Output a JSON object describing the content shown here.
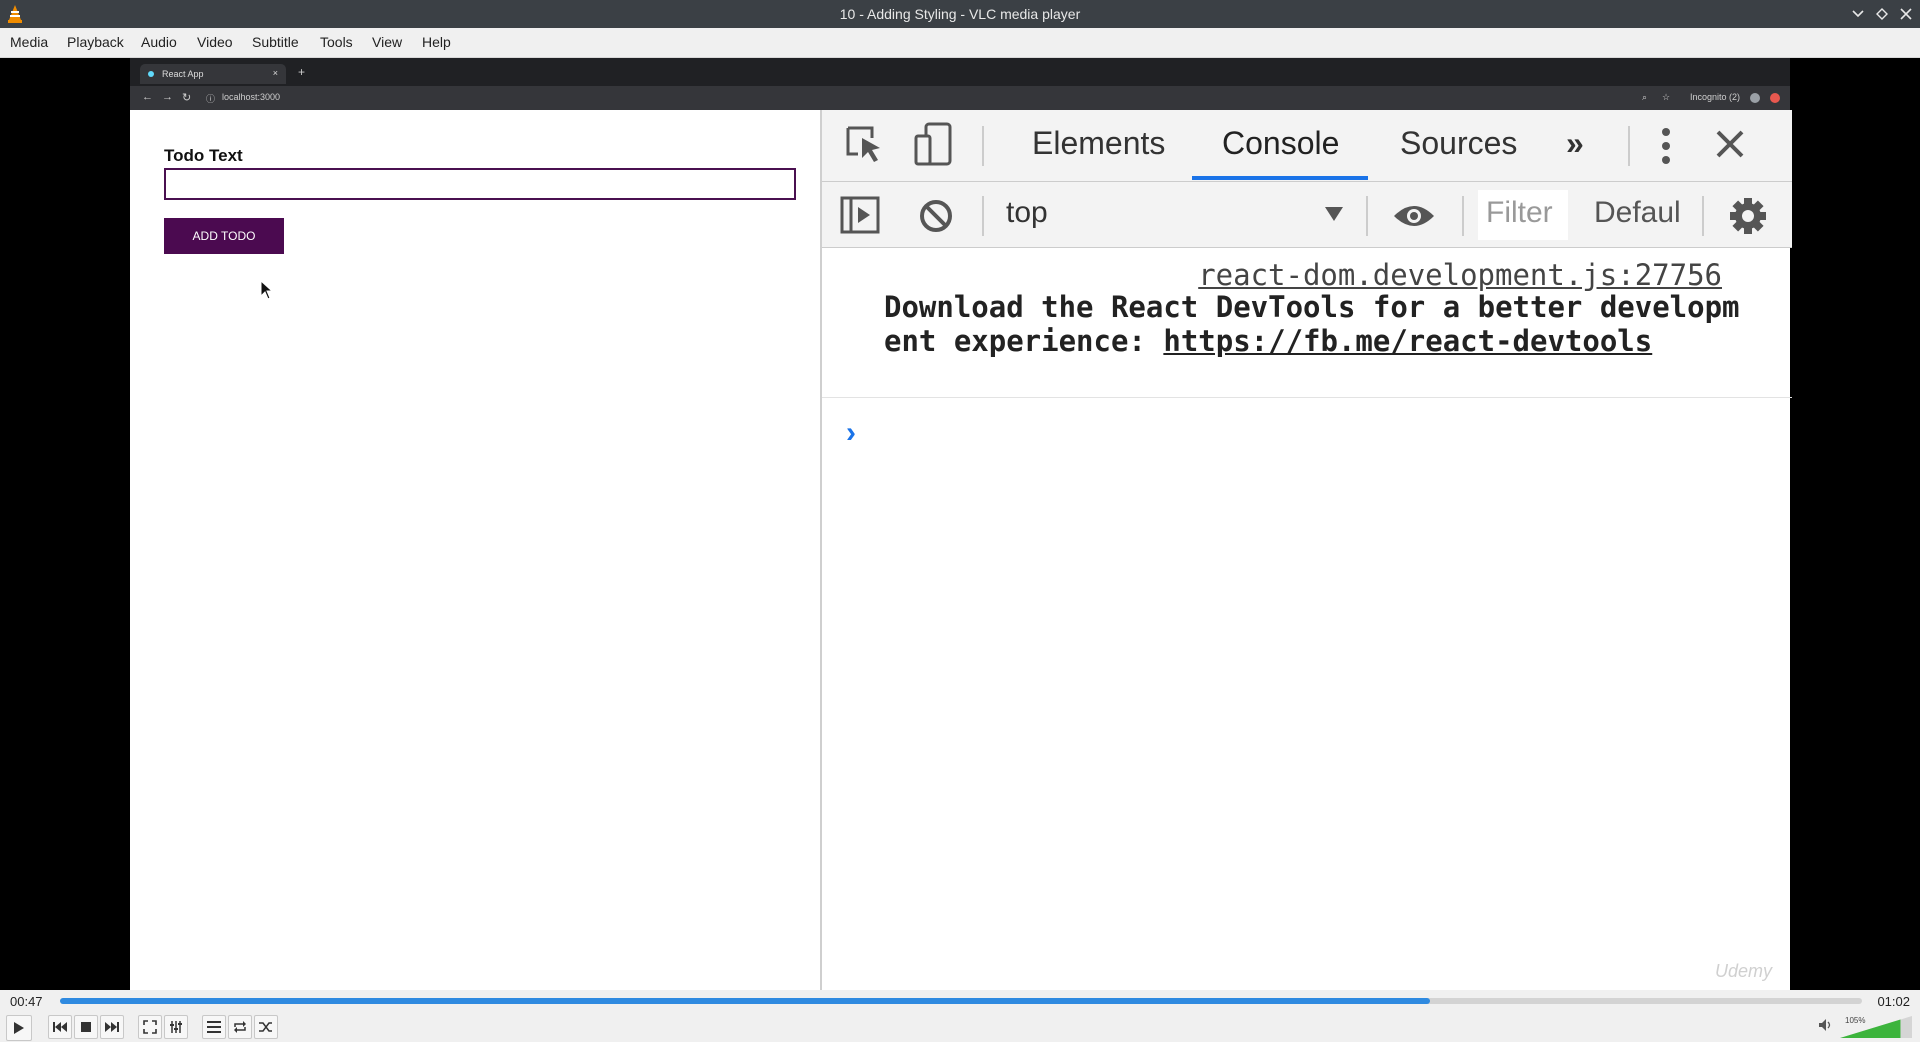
{
  "window": {
    "title": "10 - Adding Styling - VLC media player"
  },
  "menu": [
    "Media",
    "Playback",
    "Audio",
    "Video",
    "Subtitle",
    "Tools",
    "View",
    "Help"
  ],
  "browser": {
    "tab_title": "React App",
    "tab_close": "×",
    "new_tab": "+",
    "url": "localhost:3000",
    "incognito": "Incognito (2)"
  },
  "page": {
    "label": "Todo Text",
    "input_value": "",
    "button": "ADD TODO"
  },
  "devtools": {
    "tabs": [
      "Elements",
      "Console",
      "Sources"
    ],
    "active_tab": "Console",
    "context": "top",
    "filter_placeholder": "Filter",
    "levels": "Defaul",
    "console": {
      "source": "react-dom.development.js:27756",
      "message_prefix": "Download the React DevTools for a better development experience: ",
      "link": "https://fb.me/react-devtools",
      "prompt": "›"
    }
  },
  "watermark": "Udemy",
  "player": {
    "time_current": "00:47",
    "time_total": "01:02",
    "progress": 0.76,
    "volume": "105%",
    "volume_level": 1.05
  }
}
